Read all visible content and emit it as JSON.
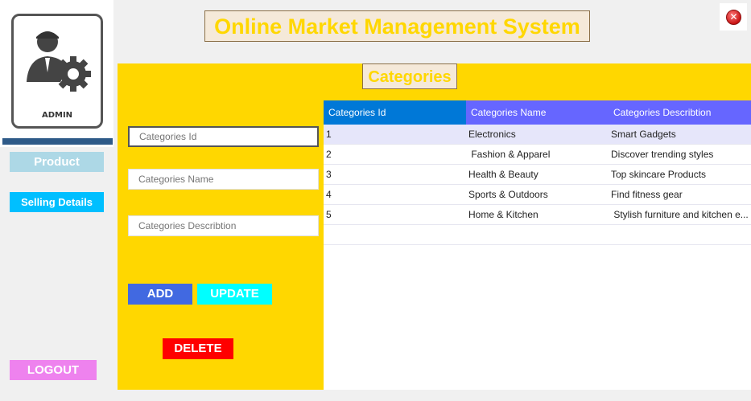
{
  "app": {
    "title": "Online Market Management System"
  },
  "sidebar": {
    "admin_label": "ADMIN",
    "items": [
      {
        "label": "Product",
        "color": "#add8e6"
      },
      {
        "label": "Selling Details",
        "color": "#00bfff"
      }
    ],
    "logout_label": "LOGOUT"
  },
  "panel": {
    "title": "Categories",
    "fields": {
      "id_placeholder": "Categories Id",
      "name_placeholder": "Categories Name",
      "desc_placeholder": "Categories Describtion"
    },
    "buttons": {
      "add": "ADD",
      "update": "UPDATE",
      "delete": "DELETE"
    }
  },
  "table": {
    "columns": [
      "Categories Id",
      "Categories Name",
      "Categories Describtion"
    ],
    "rows": [
      [
        "1",
        "Electronics",
        "Smart Gadgets"
      ],
      [
        "2",
        " Fashion & Apparel",
        "Discover trending styles"
      ],
      [
        "3",
        "Health & Beauty",
        "Top skincare Products"
      ],
      [
        "4",
        "Sports & Outdoors",
        "Find fitness gear"
      ],
      [
        "5",
        "Home & Kitchen",
        " Stylish furniture and kitchen e..."
      ]
    ],
    "selected_row": 0
  },
  "colors": {
    "panel": "#ffd700",
    "add": "#4169e1",
    "update": "#00ffff",
    "delete": "#ff0000",
    "logout": "#ee82ee",
    "header": "#6666ff",
    "header_first": "#0078d7"
  },
  "icons": {
    "admin": "admin-gear-icon",
    "close": "close-icon"
  }
}
